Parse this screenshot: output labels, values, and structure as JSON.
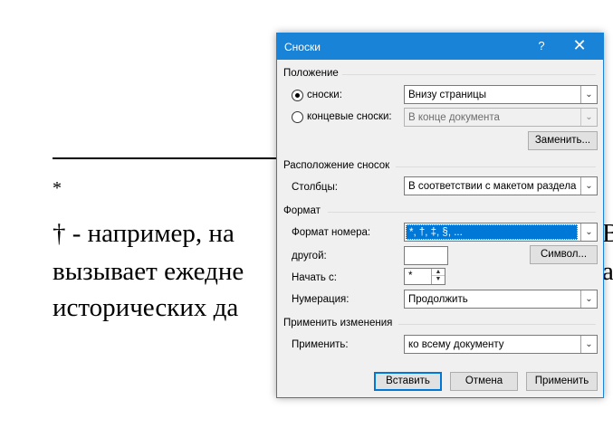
{
  "document": {
    "footnote_star": "*",
    "line1": "† - например, на",
    "line2": "вызывает ежедне",
    "line3": "исторических да",
    "right_line1": "В",
    "right_line2": "а"
  },
  "dialog": {
    "title": "Сноски",
    "help_glyph": "?",
    "close_glyph": "✕",
    "position_group": {
      "label": "Положение",
      "footnotes_label": "сноски:",
      "footnotes_value": "Внизу страницы",
      "footnotes_selected": true,
      "endnotes_label": "концевые сноски:",
      "endnotes_value": "В конце документа",
      "convert_button": "Заменить..."
    },
    "layout_group": {
      "label": "Расположение сносок",
      "columns_label": "Столбцы:",
      "columns_value": "В соответствии с макетом раздела"
    },
    "format_group": {
      "label": "Формат",
      "number_format_label": "Формат номера:",
      "number_format_value": "*, †, ‡, §, ...",
      "custom_mark_label": "другой:",
      "custom_mark_value": "",
      "symbol_button": "Символ...",
      "start_at_label": "Начать с:",
      "start_at_value": "*",
      "numbering_label": "Нумерация:",
      "numbering_value": "Продолжить"
    },
    "apply_group": {
      "label": "Применить изменения",
      "apply_to_label": "Применить:",
      "apply_to_value": "ко всему документу"
    },
    "buttons": {
      "insert": "Вставить",
      "cancel": "Отмена",
      "apply": "Применить"
    }
  }
}
